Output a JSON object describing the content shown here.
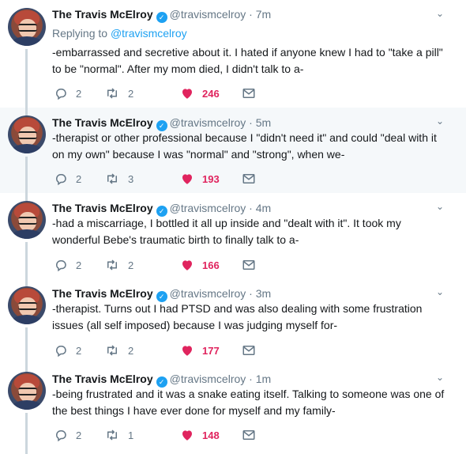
{
  "author": {
    "name": "The Travis McElroy",
    "handle": "@travismcelroy",
    "verified_glyph": "✓"
  },
  "separator": "·",
  "caret_glyph": "⌄",
  "reply_to": {
    "prefix": "Replying to",
    "mention": "@travismcelroy"
  },
  "colors": {
    "accent": "#1da1f2",
    "like": "#e0245e",
    "muted": "#657786",
    "highlight_bg": "#f5f8fa"
  },
  "tweets": [
    {
      "time": "7m",
      "text": "-embarrassed and secretive about it. I hated if anyone knew I had to \"take a pill\" to be \"normal\". After my mom died, I didn't talk to a-",
      "replies": "2",
      "retweets": "2",
      "likes": "246",
      "liked": true
    },
    {
      "time": "5m",
      "text": "-therapist or other professional because I \"didn't need it\" and could \"deal with it on my own\" because I was \"normal\" and \"strong\", when we-",
      "replies": "2",
      "retweets": "3",
      "likes": "193",
      "liked": true
    },
    {
      "time": "4m",
      "text": "-had a miscarriage, I bottled it all up inside and \"dealt with it\". It took my wonderful Bebe's traumatic birth to finally talk to a-",
      "replies": "2",
      "retweets": "2",
      "likes": "166",
      "liked": true
    },
    {
      "time": "3m",
      "text": "-therapist. Turns out I had PTSD and was also dealing with some frustration issues (all self imposed) because I was judging myself for-",
      "replies": "2",
      "retweets": "2",
      "likes": "177",
      "liked": true
    },
    {
      "time": "1m",
      "text": "-being frustrated and it was a snake eating itself. Talking to someone was one of the best things I have ever done for myself and my family-",
      "replies": "2",
      "retweets": "1",
      "likes": "148",
      "liked": true
    }
  ]
}
